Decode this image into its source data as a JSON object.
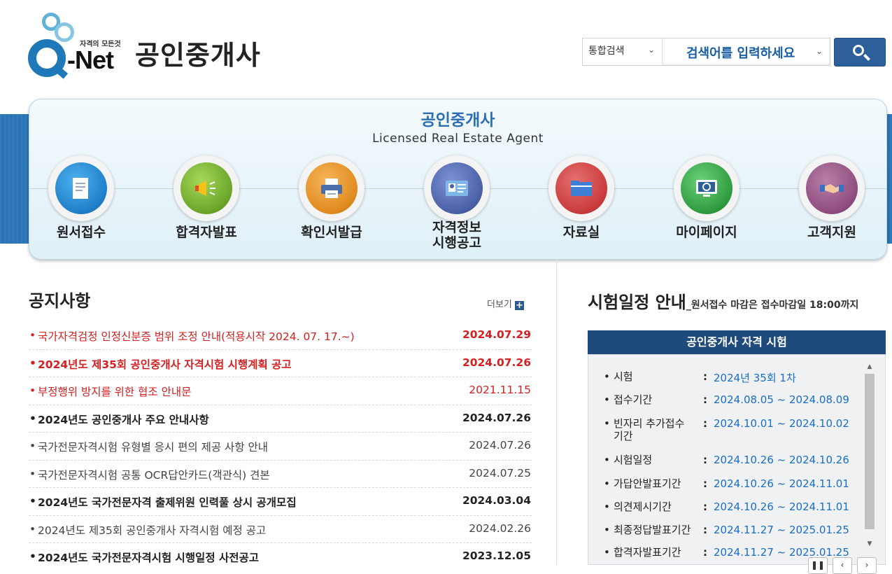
{
  "header": {
    "logo_tagline": "자격의 모든것",
    "logo_wordmark": "-Net",
    "site_title": "공인중개사"
  },
  "search": {
    "scope": "통합검색",
    "placeholder": "검색어를 입력하세요"
  },
  "banner": {
    "title": "공인중개사",
    "subtitle": "Licensed Real Estate Agent"
  },
  "menu": [
    {
      "label": "원서접수",
      "icon": "document-icon",
      "color": "#1f7fc8"
    },
    {
      "label": "합격자발표",
      "icon": "megaphone-icon",
      "color": "#6aa52a"
    },
    {
      "label": "확인서발급",
      "icon": "printer-icon",
      "color": "#e08a1e"
    },
    {
      "label": "자격정보\n시행공고",
      "icon": "id-card-icon",
      "color": "#4a5fa5"
    },
    {
      "label": "자료실",
      "icon": "folder-icon",
      "color": "#c93a3a"
    },
    {
      "label": "마이페이지",
      "icon": "monitor-icon",
      "color": "#2f9a3e"
    },
    {
      "label": "고객지원",
      "icon": "handshake-icon",
      "color": "#8e4c7e"
    }
  ],
  "notices": {
    "title": "공지사항",
    "more_label": "더보기",
    "items": [
      {
        "title": "국가자격검정 인정신분증 범위 조정 안내(적용시작 2024. 07. 17.~)",
        "date": "2024.07.29"
      },
      {
        "title": "2024년도 제35회 공인중개사 자격시험 시행계획 공고",
        "date": "2024.07.26"
      },
      {
        "title": "부정행위 방지를 위한 협조 안내문",
        "date": "2021.11.15"
      },
      {
        "title": "2024년도 공인중개사 주요 안내사항",
        "date": "2024.07.26"
      },
      {
        "title": "국가전문자격시험 유형별 응시 편의 제공 사항 안내",
        "date": "2024.07.26"
      },
      {
        "title": "국가전문자격시험 공통 OCR답안카드(객관식) 견본",
        "date": "2024.07.25"
      },
      {
        "title": "2024년도 국가전문자격 출제위원 인력풀 상시 공개모집",
        "date": "2024.03.04"
      },
      {
        "title": "2024년도 제35회 공인중개사 자격시험 예정 공고",
        "date": "2024.02.26"
      },
      {
        "title": "2024년도 국가전문자격시험 시행일정 사전공고",
        "date": "2023.12.05"
      }
    ]
  },
  "schedule": {
    "title": "시험일정 안내",
    "subtitle": "_원서접수 마감은 접수마감일 18:00까지",
    "box_title": "공인중개사 자격 시험",
    "rows": [
      {
        "key": "시험",
        "value": "2024년 35회 1차"
      },
      {
        "key": "접수기간",
        "value": "2024.08.05 ~ 2024.08.09"
      },
      {
        "key": "빈자리 추가접수기간",
        "value": "2024.10.01 ~ 2024.10.02"
      },
      {
        "key": "시험일정",
        "value": "2024.10.26 ~ 2024.10.26"
      },
      {
        "key": "가답안발표기간",
        "value": "2024.10.26 ~ 2024.11.01"
      },
      {
        "key": "의견제시기간",
        "value": "2024.10.26 ~ 2024.11.01"
      },
      {
        "key": "최종정답발표기간",
        "value": "2024.11.27 ~ 2025.01.25"
      },
      {
        "key": "합격자발표기간",
        "value": "2024.11.27 ~ 2025.01.25"
      }
    ]
  }
}
